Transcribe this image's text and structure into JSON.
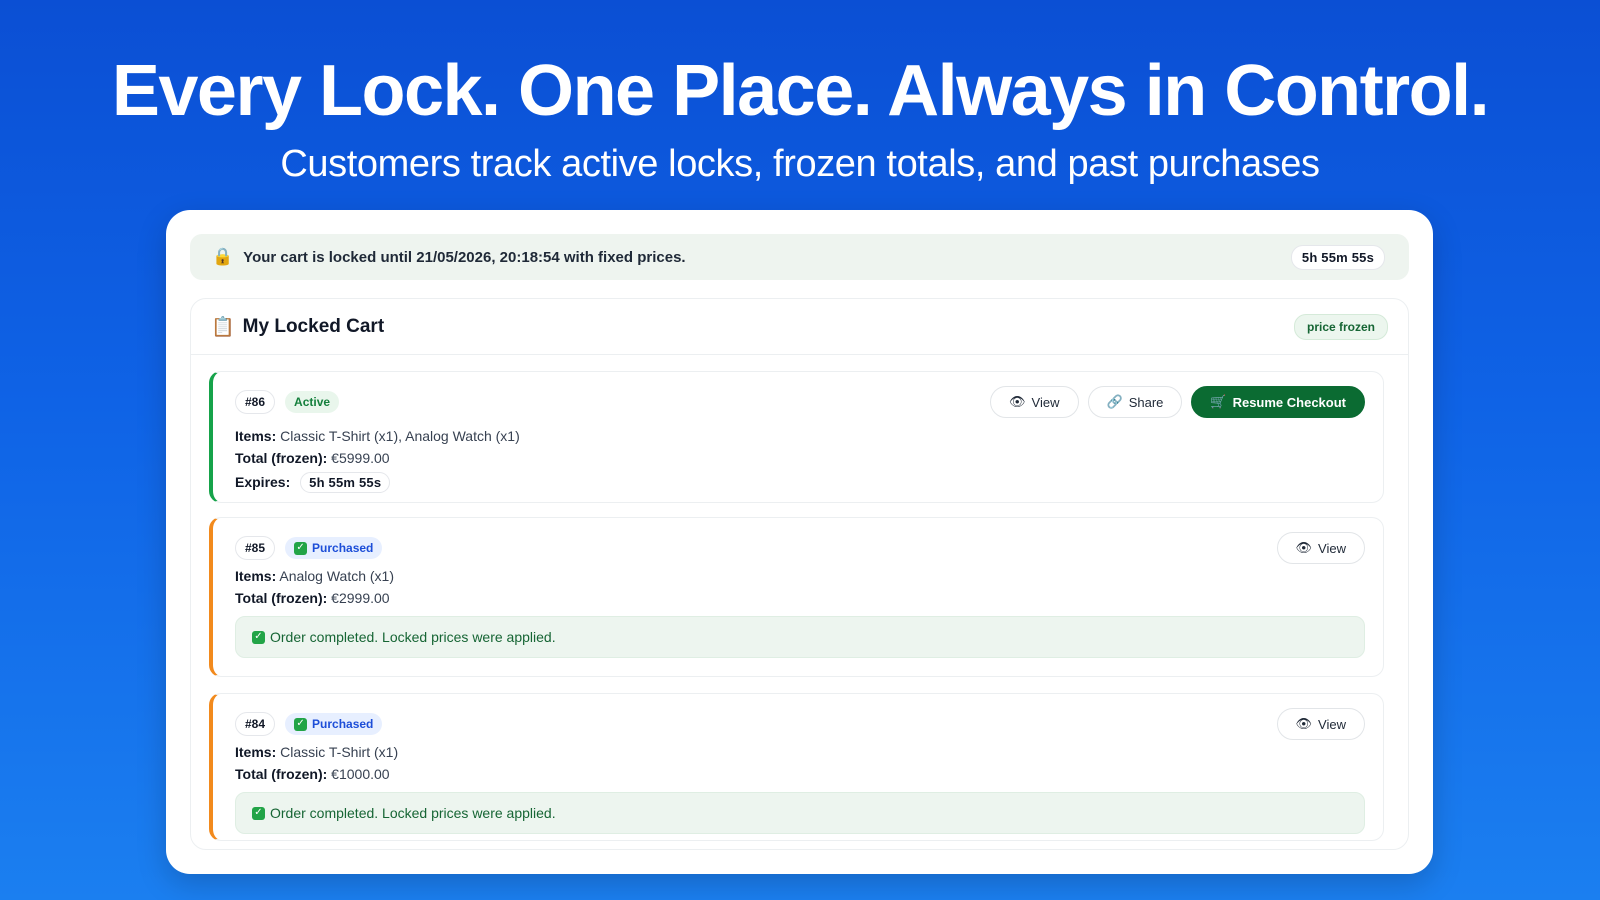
{
  "hero": {
    "title": "Every Lock. One Place. Always in Control.",
    "subtitle": "Customers track active locks, frozen totals, and past purchases"
  },
  "banner": {
    "icon": "lock-icon",
    "text": "Your cart is locked until 21/05/2026, 20:18:54 with fixed prices.",
    "timer": "5h  55m  55s"
  },
  "cart": {
    "icon": "clipboard-icon",
    "title": "My Locked Cart",
    "badge": "price frozen",
    "locks": [
      {
        "id": "#86",
        "status": "Active",
        "items_label": "Items:",
        "items": "Classic T-Shirt (x1), Analog Watch (x1)",
        "total_label": "Total (frozen):",
        "total": "€5999.00",
        "expires_label": "Expires:",
        "expires": "5h  55m  55s",
        "actions": {
          "view": "View",
          "share": "Share",
          "resume": "Resume Checkout"
        }
      },
      {
        "id": "#85",
        "status": "Purchased",
        "items_label": "Items:",
        "items": "Analog Watch (x1)",
        "total_label": "Total (frozen):",
        "total": "€2999.00",
        "note": "Order completed. Locked prices were applied.",
        "actions": {
          "view": "View"
        }
      },
      {
        "id": "#84",
        "status": "Purchased",
        "items_label": "Items:",
        "items": "Classic T-Shirt (x1)",
        "total_label": "Total (frozen):",
        "total": "€1000.00",
        "note": "Order completed. Locked prices were applied.",
        "actions": {
          "view": "View"
        }
      }
    ]
  },
  "colors": {
    "background_top": "#0b4fd4",
    "background_bottom": "#1b7ff0",
    "active_accent": "#16a34a",
    "purchased_accent": "#f28a1d",
    "primary_button": "#0b6b32"
  }
}
